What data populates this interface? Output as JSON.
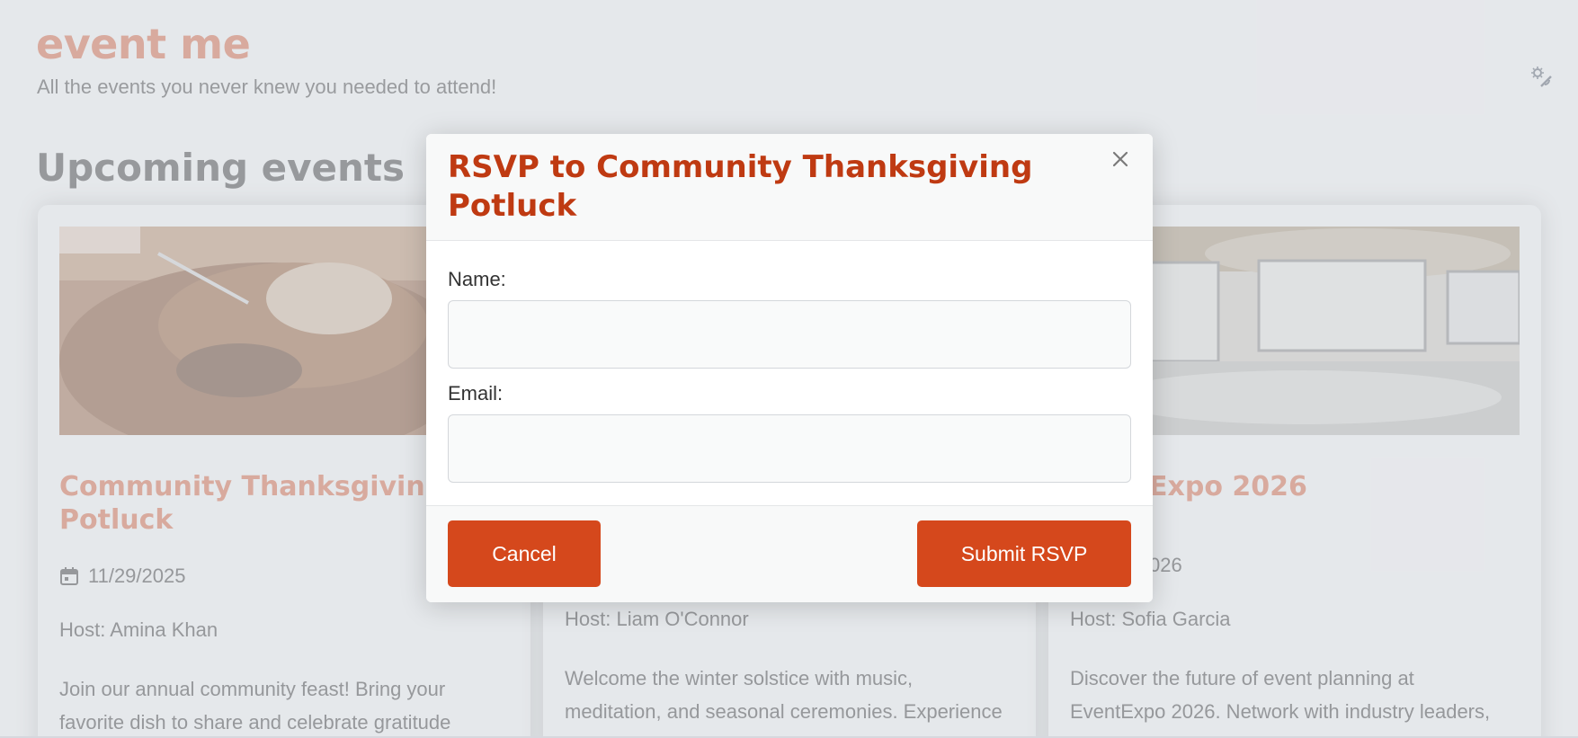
{
  "header": {
    "brand": "event me",
    "tagline": "All the events you never knew you needed to attend!",
    "theme_toggle_icon": "theme-toggle-icon"
  },
  "main": {
    "section_title": "Upcoming events",
    "events": [
      {
        "title": "Community Thanksgiving Potluck",
        "date": "11/29/2025",
        "host": "Host: Amina Khan",
        "description": "Join our annual community feast! Bring your favorite dish to share and celebrate gratitude",
        "image_icon": "roast-turkey-image"
      },
      {
        "title": "",
        "date": "",
        "host": "Host: Liam O'Connor",
        "description": "Welcome the winter solstice with music, meditation, and seasonal ceremonies. Experience the magic of the longest night of",
        "image_icon": ""
      },
      {
        "title": "Expo 2026",
        "date": "026",
        "host": "Host: Sofia Garcia",
        "description": "Discover the future of event planning at EventExpo 2026. Network with industry leaders, explore cutting-edge technologies",
        "image_icon": "conference-hall-image"
      }
    ]
  },
  "modal": {
    "title": "RSVP to Community Thanksgiving Potluck",
    "close_icon": "close-icon",
    "name_label": "Name:",
    "name_value": "",
    "email_label": "Email:",
    "email_value": "",
    "cancel_label": "Cancel",
    "submit_label": "Submit RSVP"
  },
  "colors": {
    "accent": "#d5481c",
    "title": "#bf3a12",
    "brand_faded": "#e8a48e"
  }
}
